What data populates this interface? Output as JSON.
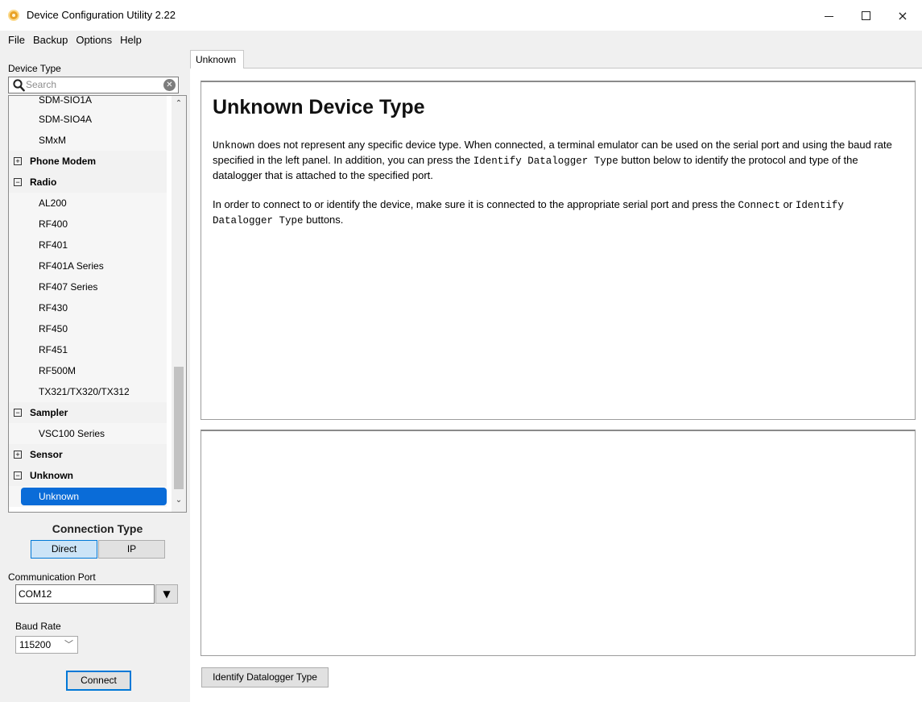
{
  "window": {
    "title": "Device Configuration Utility 2.22",
    "controls": {
      "minimize": "minimize-icon",
      "maximize": "maximize-icon",
      "close": "×"
    }
  },
  "menu": [
    "File",
    "Backup",
    "Options",
    "Help"
  ],
  "sidebar": {
    "device_type_label": "Device Type",
    "search_placeholder": "Search",
    "tree": [
      {
        "kind": "child",
        "label": "SDM-SIO1A",
        "partial": true
      },
      {
        "kind": "child",
        "label": "SDM-SIO4A"
      },
      {
        "kind": "child",
        "label": "SMxM"
      },
      {
        "kind": "group",
        "label": "Phone Modem",
        "toggle": "⊞"
      },
      {
        "kind": "group",
        "label": "Radio",
        "toggle": "⊟"
      },
      {
        "kind": "child",
        "label": "AL200"
      },
      {
        "kind": "child",
        "label": "RF400"
      },
      {
        "kind": "child",
        "label": "RF401"
      },
      {
        "kind": "child",
        "label": "RF401A Series"
      },
      {
        "kind": "child",
        "label": "RF407 Series"
      },
      {
        "kind": "child",
        "label": "RF430"
      },
      {
        "kind": "child",
        "label": "RF450"
      },
      {
        "kind": "child",
        "label": "RF451"
      },
      {
        "kind": "child",
        "label": "RF500M"
      },
      {
        "kind": "child",
        "label": "TX321/TX320/TX312"
      },
      {
        "kind": "group",
        "label": "Sampler",
        "toggle": "⊟"
      },
      {
        "kind": "child",
        "label": "VSC100 Series"
      },
      {
        "kind": "group",
        "label": "Sensor",
        "toggle": "⊞"
      },
      {
        "kind": "group",
        "label": "Unknown",
        "toggle": "⊟"
      },
      {
        "kind": "child",
        "label": "Unknown",
        "selected": true
      }
    ],
    "connection": {
      "title": "Connection Type",
      "options": [
        "Direct",
        "IP"
      ],
      "selected": "Direct"
    },
    "comm_port": {
      "label": "Communication Port",
      "value": "COM12"
    },
    "baud_rate": {
      "label": "Baud Rate",
      "value": "115200"
    },
    "connect_label": "Connect"
  },
  "main": {
    "tab_label": "Unknown",
    "heading": "Unknown Device Type",
    "para1": [
      {
        "t": "Unknown",
        "mono": true
      },
      {
        "t": " does not represent any specific device type. When connected, a terminal emulator can be used on the serial port and using the baud rate specified in the left panel. In addition, you can press the "
      },
      {
        "t": "Identify Datalogger Type",
        "mono": true
      },
      {
        "t": " button below to identify the protocol and type of the datalogger that is attached to the specified port."
      }
    ],
    "para2": [
      {
        "t": "In order to connect to or identify the device, make sure it is connected to the appropriate serial port and press the "
      },
      {
        "t": "Connect",
        "mono": true
      },
      {
        "t": " or "
      },
      {
        "t": "Identify Datalogger Type",
        "mono": true
      },
      {
        "t": " buttons."
      }
    ],
    "identify_label": "Identify Datalogger Type"
  },
  "colors": {
    "accent": "#0078d7",
    "selected_row": "#0a6cd8",
    "app_icon": "#e9a226"
  }
}
